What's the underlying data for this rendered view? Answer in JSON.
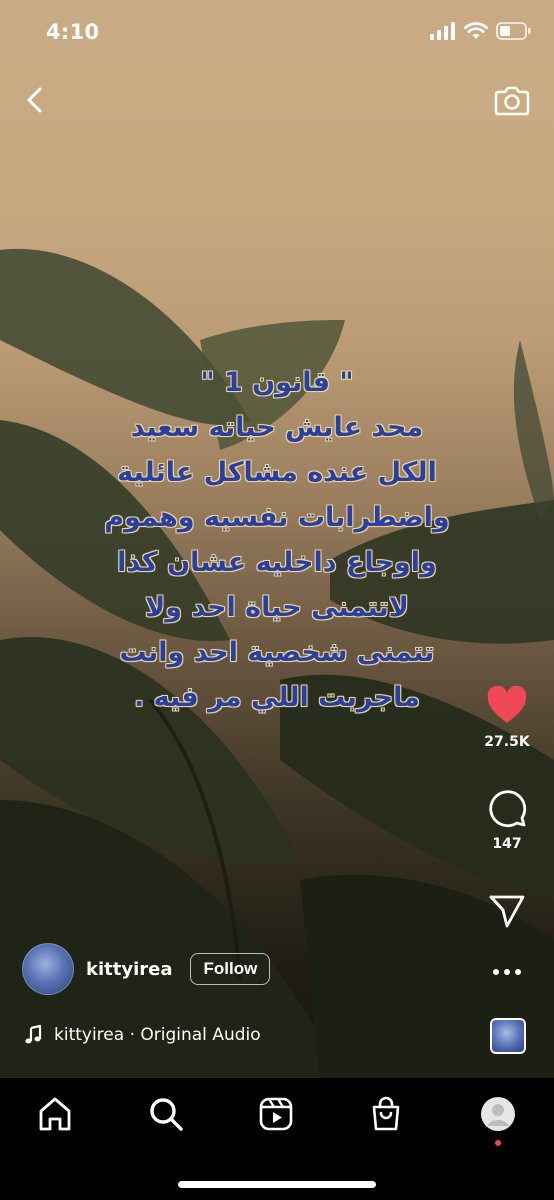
{
  "status_bar": {
    "time": "4:10"
  },
  "top_bar": {
    "back_icon": "chevron-left-icon",
    "camera_icon": "camera-icon"
  },
  "overlay_lines": [
    "\" قانون 1 \"",
    "محد عايش حياته سعيد",
    "الكل عنده مشاكل عائلية",
    "واضطرابات نفسيه وهموم",
    "واوجاع داخليه عشان كذا",
    "لاتتمنى حياة احد ولا",
    "تتمنى شخصية احد وانت",
    "ماجربت اللي مر فيه ."
  ],
  "actions": {
    "like_count": "27.5K",
    "comment_count": "147",
    "like_color": "#ed4956"
  },
  "author": {
    "username": "kittyirea",
    "follow_label": "Follow"
  },
  "audio": {
    "label": "kittyirea · Original Audio"
  },
  "tabs": [
    "home-icon",
    "search-icon",
    "reels-icon",
    "shop-icon",
    "profile-avatar"
  ]
}
